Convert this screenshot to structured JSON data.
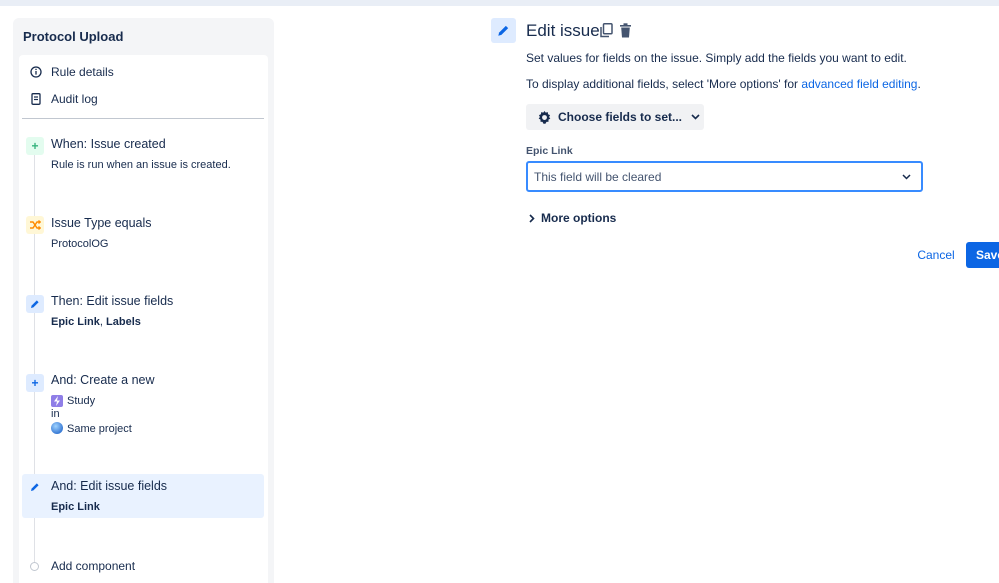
{
  "sidebar": {
    "title": "Protocol Upload",
    "meta": [
      {
        "label": "Rule details",
        "icon": "info-icon"
      },
      {
        "label": "Audit log",
        "icon": "document-icon"
      }
    ],
    "steps": [
      {
        "title": "When: Issue created",
        "desc": "Rule is run when an issue is created.",
        "icon": "plus-icon",
        "color": "#36b37e"
      },
      {
        "title": "Issue Type equals",
        "desc": "ProtocolOG",
        "icon": "shuffle-icon",
        "color": "#ff8b00"
      },
      {
        "title": "Then: Edit issue fields",
        "desc_bold_1": "Epic Link",
        "desc_sep": ", ",
        "desc_bold_2": "Labels",
        "icon": "pencil-icon",
        "color": "#0c66e4"
      },
      {
        "title": "And: Create a new",
        "line1": "Study",
        "line2": "in",
        "line3": "Same project",
        "icon": "plus-icon",
        "color": "#0c66e4"
      },
      {
        "title": "And: Edit issue fields",
        "desc_bold": "Epic Link",
        "icon": "pencil-icon",
        "color": "#0c66e4",
        "active": true
      }
    ],
    "add_component": "Add component"
  },
  "editor": {
    "title": "Edit issue",
    "desc1": "Set values for fields on the issue. Simply add the fields you want to edit.",
    "desc2_prefix": "To display additional fields, select 'More options' for ",
    "desc2_link": "advanced field editing",
    "desc2_suffix": ".",
    "choose_button": "Choose fields to set...",
    "field_label": "Epic Link",
    "field_value": "This field will be cleared",
    "more_options": "More options",
    "cancel": "Cancel",
    "save": "Save"
  },
  "colors": {
    "accent": "#0c66e4",
    "focus_border": "#388bff",
    "panel_bg": "#f4f5f7"
  }
}
